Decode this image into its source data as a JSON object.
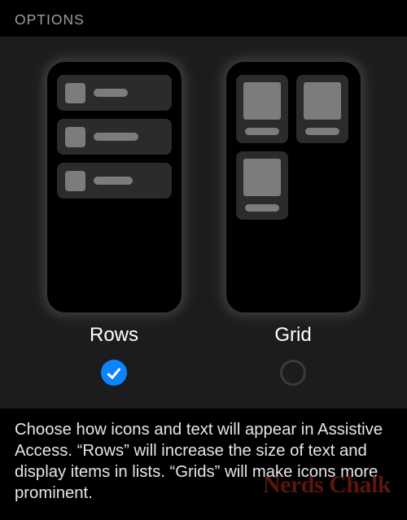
{
  "header": {
    "title": "OPTIONS"
  },
  "options": {
    "rows": {
      "label": "Rows",
      "selected": true
    },
    "grid": {
      "label": "Grid",
      "selected": false
    }
  },
  "footer": {
    "text": "Choose how icons and text will appear in Assistive Access. “Rows” will increase the size of text and display items in lists. “Grids” will make icons more prominent."
  },
  "watermark": {
    "text": "Nerds Chalk"
  }
}
